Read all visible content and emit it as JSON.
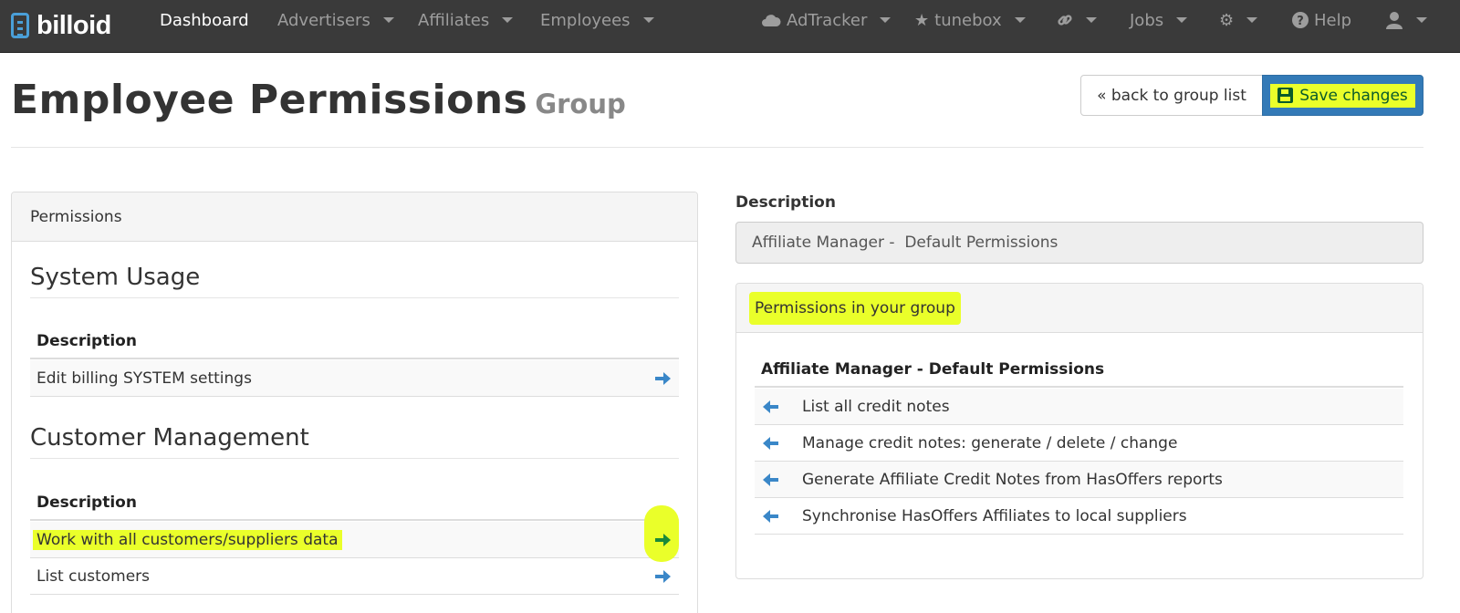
{
  "navbar": {
    "brand": "billoid",
    "items": [
      {
        "label": "Dashboard",
        "active": true
      },
      {
        "label": "Advertisers"
      },
      {
        "label": "Affiliates"
      },
      {
        "label": "Employees"
      }
    ],
    "right_items": [
      {
        "label": "AdTracker",
        "icon": "cloud-icon"
      },
      {
        "label": "tunebox",
        "icon": "star-icon"
      },
      {
        "label": "",
        "icon": "link-icon"
      },
      {
        "label": "Jobs"
      },
      {
        "label": "",
        "icon": "gear-icon"
      },
      {
        "label": "Help",
        "icon": "question-circle-icon"
      },
      {
        "label": "",
        "icon": "user-icon"
      }
    ]
  },
  "header": {
    "title": "Employee Permissions",
    "subtitle": "Group",
    "back_label": "« back to group list",
    "save_label": "Save changes"
  },
  "left_panel": {
    "heading": "Permissions",
    "sections": [
      {
        "title": "System Usage",
        "column_header": "Description",
        "rows": [
          {
            "label": "Edit billing SYSTEM settings"
          }
        ]
      },
      {
        "title": "Customer Management",
        "column_header": "Description",
        "rows": [
          {
            "label": "Work with all customers/suppliers data",
            "highlighted": true
          },
          {
            "label": "List customers"
          }
        ]
      }
    ]
  },
  "right_panel": {
    "description_label": "Description",
    "description_value": "Affiliate Manager -  Default Permissions",
    "group_heading": "Permissions in your group",
    "group_column_header": "Affiliate Manager - Default Permissions",
    "group_rows": [
      {
        "label": "List all credit notes"
      },
      {
        "label": "Manage credit notes: generate / delete / change"
      },
      {
        "label": "Generate Affiliate Credit Notes from HasOffers reports"
      },
      {
        "label": "Synchronise HasOffers Affiliates to local suppliers"
      }
    ]
  },
  "colors": {
    "navbar_bg": "#3a3a3a",
    "primary": "#337ab7",
    "highlight": "#eaff2a",
    "arrow": "#3a87c8",
    "arrow_highlighted": "#1a8a3a"
  }
}
